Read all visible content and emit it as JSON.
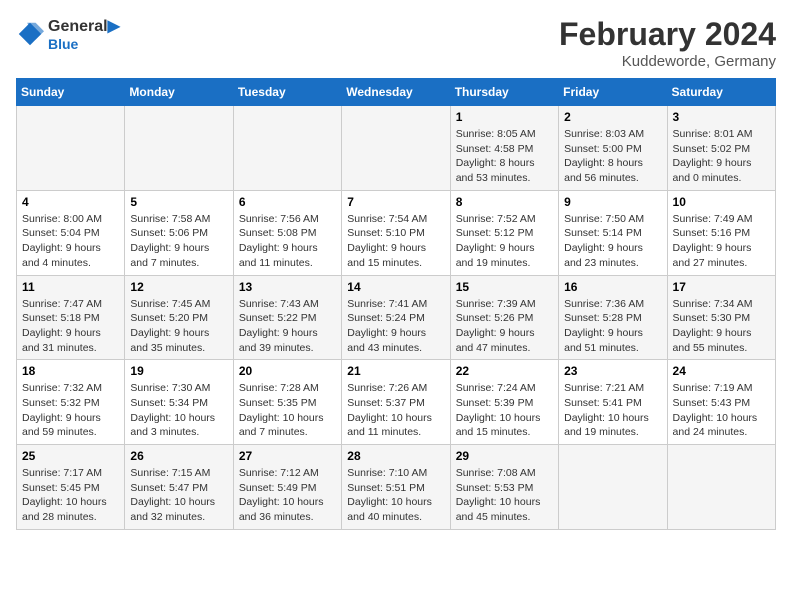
{
  "header": {
    "logo_line1": "General",
    "logo_line2": "Blue",
    "main_title": "February 2024",
    "subtitle": "Kuddeworde, Germany"
  },
  "days_of_week": [
    "Sunday",
    "Monday",
    "Tuesday",
    "Wednesday",
    "Thursday",
    "Friday",
    "Saturday"
  ],
  "weeks": [
    {
      "days": [
        {
          "number": "",
          "info": ""
        },
        {
          "number": "",
          "info": ""
        },
        {
          "number": "",
          "info": ""
        },
        {
          "number": "",
          "info": ""
        },
        {
          "number": "1",
          "info": "Sunrise: 8:05 AM\nSunset: 4:58 PM\nDaylight: 8 hours\nand 53 minutes."
        },
        {
          "number": "2",
          "info": "Sunrise: 8:03 AM\nSunset: 5:00 PM\nDaylight: 8 hours\nand 56 minutes."
        },
        {
          "number": "3",
          "info": "Sunrise: 8:01 AM\nSunset: 5:02 PM\nDaylight: 9 hours\nand 0 minutes."
        }
      ]
    },
    {
      "days": [
        {
          "number": "4",
          "info": "Sunrise: 8:00 AM\nSunset: 5:04 PM\nDaylight: 9 hours\nand 4 minutes."
        },
        {
          "number": "5",
          "info": "Sunrise: 7:58 AM\nSunset: 5:06 PM\nDaylight: 9 hours\nand 7 minutes."
        },
        {
          "number": "6",
          "info": "Sunrise: 7:56 AM\nSunset: 5:08 PM\nDaylight: 9 hours\nand 11 minutes."
        },
        {
          "number": "7",
          "info": "Sunrise: 7:54 AM\nSunset: 5:10 PM\nDaylight: 9 hours\nand 15 minutes."
        },
        {
          "number": "8",
          "info": "Sunrise: 7:52 AM\nSunset: 5:12 PM\nDaylight: 9 hours\nand 19 minutes."
        },
        {
          "number": "9",
          "info": "Sunrise: 7:50 AM\nSunset: 5:14 PM\nDaylight: 9 hours\nand 23 minutes."
        },
        {
          "number": "10",
          "info": "Sunrise: 7:49 AM\nSunset: 5:16 PM\nDaylight: 9 hours\nand 27 minutes."
        }
      ]
    },
    {
      "days": [
        {
          "number": "11",
          "info": "Sunrise: 7:47 AM\nSunset: 5:18 PM\nDaylight: 9 hours\nand 31 minutes."
        },
        {
          "number": "12",
          "info": "Sunrise: 7:45 AM\nSunset: 5:20 PM\nDaylight: 9 hours\nand 35 minutes."
        },
        {
          "number": "13",
          "info": "Sunrise: 7:43 AM\nSunset: 5:22 PM\nDaylight: 9 hours\nand 39 minutes."
        },
        {
          "number": "14",
          "info": "Sunrise: 7:41 AM\nSunset: 5:24 PM\nDaylight: 9 hours\nand 43 minutes."
        },
        {
          "number": "15",
          "info": "Sunrise: 7:39 AM\nSunset: 5:26 PM\nDaylight: 9 hours\nand 47 minutes."
        },
        {
          "number": "16",
          "info": "Sunrise: 7:36 AM\nSunset: 5:28 PM\nDaylight: 9 hours\nand 51 minutes."
        },
        {
          "number": "17",
          "info": "Sunrise: 7:34 AM\nSunset: 5:30 PM\nDaylight: 9 hours\nand 55 minutes."
        }
      ]
    },
    {
      "days": [
        {
          "number": "18",
          "info": "Sunrise: 7:32 AM\nSunset: 5:32 PM\nDaylight: 9 hours\nand 59 minutes."
        },
        {
          "number": "19",
          "info": "Sunrise: 7:30 AM\nSunset: 5:34 PM\nDaylight: 10 hours\nand 3 minutes."
        },
        {
          "number": "20",
          "info": "Sunrise: 7:28 AM\nSunset: 5:35 PM\nDaylight: 10 hours\nand 7 minutes."
        },
        {
          "number": "21",
          "info": "Sunrise: 7:26 AM\nSunset: 5:37 PM\nDaylight: 10 hours\nand 11 minutes."
        },
        {
          "number": "22",
          "info": "Sunrise: 7:24 AM\nSunset: 5:39 PM\nDaylight: 10 hours\nand 15 minutes."
        },
        {
          "number": "23",
          "info": "Sunrise: 7:21 AM\nSunset: 5:41 PM\nDaylight: 10 hours\nand 19 minutes."
        },
        {
          "number": "24",
          "info": "Sunrise: 7:19 AM\nSunset: 5:43 PM\nDaylight: 10 hours\nand 24 minutes."
        }
      ]
    },
    {
      "days": [
        {
          "number": "25",
          "info": "Sunrise: 7:17 AM\nSunset: 5:45 PM\nDaylight: 10 hours\nand 28 minutes."
        },
        {
          "number": "26",
          "info": "Sunrise: 7:15 AM\nSunset: 5:47 PM\nDaylight: 10 hours\nand 32 minutes."
        },
        {
          "number": "27",
          "info": "Sunrise: 7:12 AM\nSunset: 5:49 PM\nDaylight: 10 hours\nand 36 minutes."
        },
        {
          "number": "28",
          "info": "Sunrise: 7:10 AM\nSunset: 5:51 PM\nDaylight: 10 hours\nand 40 minutes."
        },
        {
          "number": "29",
          "info": "Sunrise: 7:08 AM\nSunset: 5:53 PM\nDaylight: 10 hours\nand 45 minutes."
        },
        {
          "number": "",
          "info": ""
        },
        {
          "number": "",
          "info": ""
        }
      ]
    }
  ]
}
